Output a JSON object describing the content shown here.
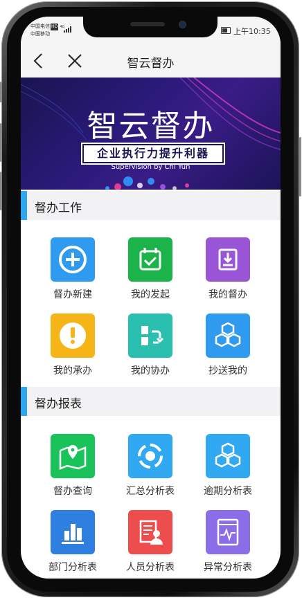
{
  "status_bar": {
    "carrier_line1": "中国电信",
    "hd_badge": "HD",
    "network": "4G",
    "carrier_line2": "中国移动",
    "time": "上午10:35"
  },
  "nav": {
    "title": "智云督办"
  },
  "banner": {
    "title": "智云督办",
    "ribbon": "企业执行力提升利器",
    "subtitle": "Supervision by Chi Yun"
  },
  "sections": [
    {
      "title": "督办工作",
      "items": [
        {
          "label": "督办新建",
          "icon": "plus-circle-icon",
          "color": "#2e9bf0"
        },
        {
          "label": "我的发起",
          "icon": "calendar-check-icon",
          "color": "#1cb34a"
        },
        {
          "label": "我的督办",
          "icon": "download-tray-icon",
          "color": "#9a55d6"
        },
        {
          "label": "我的承办",
          "icon": "exclamation-icon",
          "color": "#f6b419"
        },
        {
          "label": "我的协办",
          "icon": "swap-icon",
          "color": "#2bbfb0"
        },
        {
          "label": "抄送我的",
          "icon": "cubes-icon",
          "color": "#2e9bf0"
        }
      ]
    },
    {
      "title": "督办报表",
      "items": [
        {
          "label": "督办查询",
          "icon": "map-pin-icon",
          "color": "#19c35a"
        },
        {
          "label": "汇总分析表",
          "icon": "refresh-cycle-icon",
          "color": "#31a8f2"
        },
        {
          "label": "逾期分析表",
          "icon": "cubes-icon",
          "color": "#31a8f2"
        },
        {
          "label": "部门分析表",
          "icon": "bar-chart-icon",
          "color": "#2f7fe0"
        },
        {
          "label": "人员分析表",
          "icon": "person-document-icon",
          "color": "#ee4d4d"
        },
        {
          "label": "异常分析表",
          "icon": "monitor-pulse-icon",
          "color": "#8c6de8"
        }
      ]
    }
  ]
}
